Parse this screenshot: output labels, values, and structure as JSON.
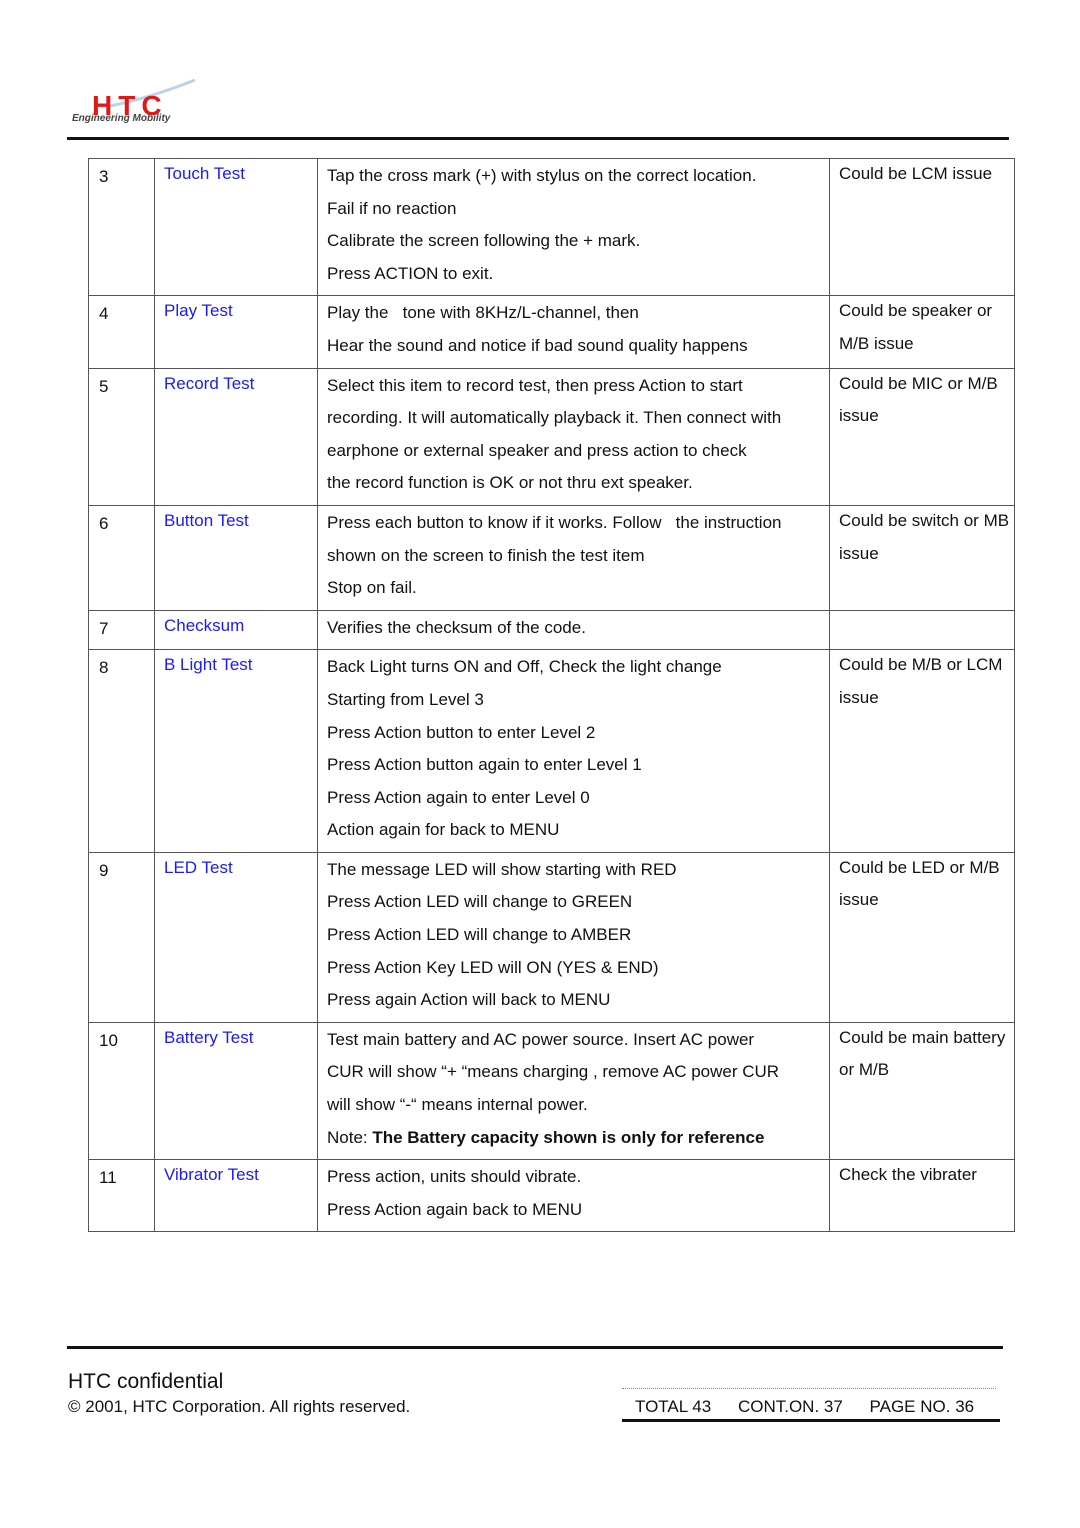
{
  "header": {
    "logo_text": "HTC",
    "logo_tagline": "Engineering Mobility",
    "brand_color": "#e01818"
  },
  "table": {
    "rows": [
      {
        "num": "3",
        "name": "Touch Test",
        "desc": [
          "Tap the cross mark (+) with stylus on the correct location.",
          "Fail if no reaction",
          "Calibrate the screen following the + mark.",
          "Press ACTION to exit."
        ],
        "cause": [
          "Could be LCM issue"
        ]
      },
      {
        "num": "4",
        "name": "Play Test",
        "desc": [
          "Play the   tone with 8KHz/L-channel, then",
          "Hear the sound and notice if bad sound quality happens"
        ],
        "cause": [
          "Could be speaker or",
          "M/B issue"
        ]
      },
      {
        "num": "5",
        "name": "Record Test",
        "desc": [
          "Select this item to record test, then press Action to start",
          "recording. It will automatically playback it. Then connect with",
          "earphone or external speaker and press action to check",
          "the record function is OK or not thru ext speaker."
        ],
        "cause": [
          "Could be MIC or M/B",
          "issue"
        ]
      },
      {
        "num": "6",
        "name": "Button Test",
        "desc": [
          "Press each button to know if it works. Follow   the instruction",
          "shown on the screen to finish the test item",
          "Stop on fail."
        ],
        "cause": [
          "Could be switch or MB",
          "issue"
        ]
      },
      {
        "num": "7",
        "name": "Checksum",
        "desc": [
          "Verifies the checksum of the code."
        ],
        "cause": []
      },
      {
        "num": "8",
        "name": "B Light Test",
        "desc": [
          "Back Light turns ON and Off, Check the light change",
          "Starting from Level 3",
          "Press Action button to enter Level 2",
          "Press Action button again to enter Level 1",
          "Press Action again to enter Level 0",
          "Action again for back to MENU"
        ],
        "cause": [
          "Could be M/B or LCM",
          "issue"
        ]
      },
      {
        "num": "9",
        "name": "LED Test",
        "desc": [
          "The message LED will show starting with RED",
          "Press Action LED will change to GREEN",
          "Press Action LED will change to AMBER",
          "Press Action Key LED will ON (YES & END)",
          "Press again Action will back to MENU"
        ],
        "cause": [
          "Could be LED or M/B",
          "issue"
        ]
      },
      {
        "num": "10",
        "name": "Battery Test",
        "desc": [
          "Test main battery and AC power source. Insert AC power",
          "CUR will show “+ “means charging , remove AC power CUR",
          "will show “-“ means internal power."
        ],
        "note_label": "Note: ",
        "note_bold": "The Battery capacity shown is only for reference",
        "cause": [
          "Could be main battery",
          "or M/B"
        ]
      },
      {
        "num": "11",
        "name": "Vibrator Test",
        "desc": [
          "Press action, units should vibrate.",
          "Press Action again back to MENU"
        ],
        "cause": [
          "Check the vibrater"
        ]
      }
    ]
  },
  "footer": {
    "confidential": "HTC confidential",
    "copyright": "© 2001, HTC Corporation. All rights reserved.",
    "total": "TOTAL 43",
    "cont_on": "CONT.ON. 37",
    "page_no": "PAGE NO. 36"
  }
}
